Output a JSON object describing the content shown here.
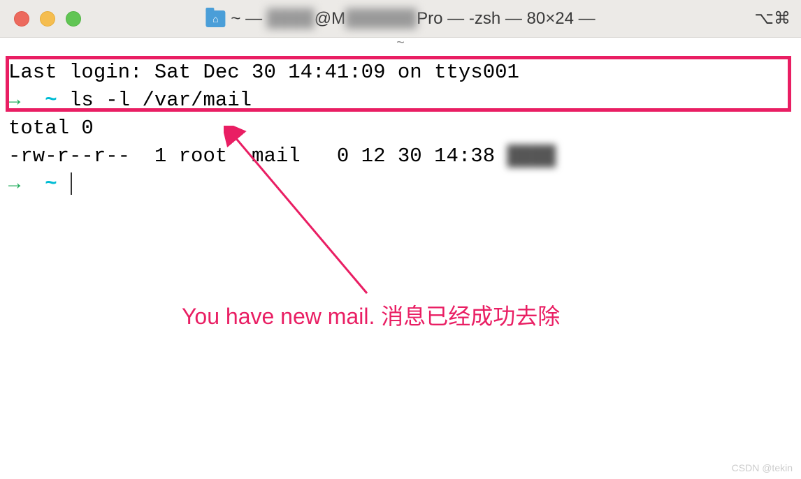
{
  "titlebar": {
    "title_prefix": "~ —",
    "title_blurred_1": "████",
    "title_mid": "@M",
    "title_blurred_2": "██████",
    "title_suffix": "Pro — -zsh — 80×24 —",
    "shortcut": "⌥⌘",
    "tab_marker": "~"
  },
  "terminal": {
    "last_login": "Last login: Sat Dec 30 14:41:09 on ttys001",
    "prompt_arrow": "→",
    "prompt_tilde": "~",
    "command1": "ls -l /var/mail",
    "total_line": "total 0",
    "ls_output_prefix": "-rw-r--r--  1 root  mail   0 12 30 14:38 ",
    "ls_output_blurred": "████"
  },
  "annotation": {
    "text": "You have new mail. 消息已经成功去除"
  },
  "watermark": "CSDN @tekin",
  "colors": {
    "highlight": "#e91e63",
    "prompt_green": "#27ae60",
    "prompt_cyan": "#00bcd4"
  }
}
